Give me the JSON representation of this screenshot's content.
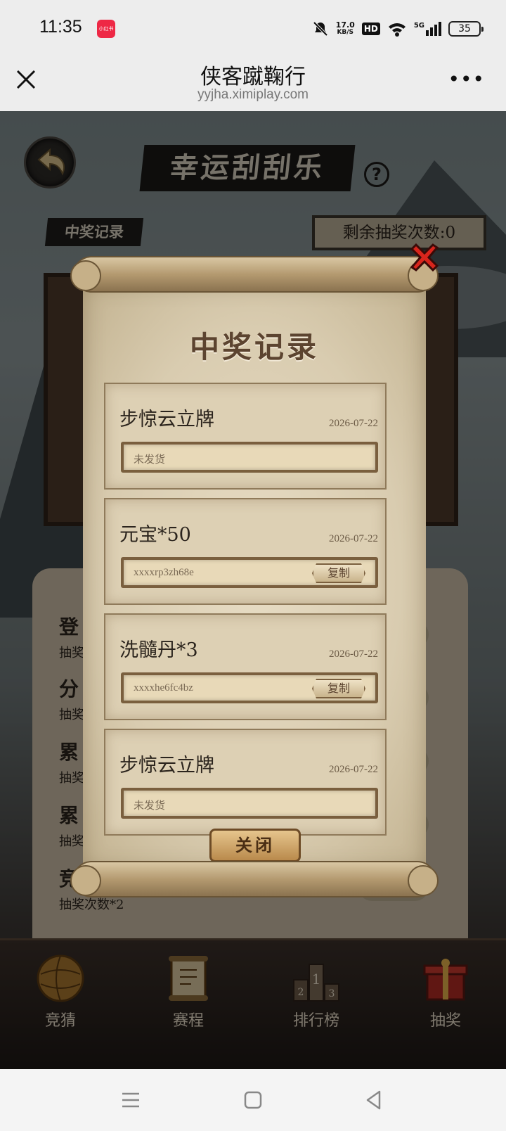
{
  "status_bar": {
    "time": "11:35",
    "app_badge": "小红书",
    "net_speed": "17.0",
    "net_unit": "KB/S",
    "hd": "HD",
    "signal": "5G",
    "battery": "35"
  },
  "nav": {
    "title": "侠客蹴鞠行",
    "url": "yyjha.ximiplay.com"
  },
  "game": {
    "title": "幸运刮刮乐",
    "help": "?",
    "record_tag": "中奖记录",
    "remaining": "剩余抽奖次数:0",
    "bg_rows": [
      {
        "title": "登",
        "sub": "抽奖"
      },
      {
        "title": "分",
        "sub": "抽奖"
      },
      {
        "title": "累",
        "sub": "抽奖"
      },
      {
        "title": "累",
        "sub": "抽奖"
      },
      {
        "title": "竞",
        "sub": "抽奖次数*2"
      }
    ],
    "tabs": [
      {
        "label": "竞猜"
      },
      {
        "label": "赛程"
      },
      {
        "label": "排行榜"
      },
      {
        "label": "抽奖"
      }
    ]
  },
  "modal": {
    "title": "中奖记录",
    "records": [
      {
        "name": "步惊云立牌",
        "date": "2026-07-22",
        "code": "未发货",
        "copy": ""
      },
      {
        "name": "元宝*50",
        "date": "2026-07-22",
        "code": "xxxxrp3zh68e",
        "copy": "复制"
      },
      {
        "name": "洗髓丹*3",
        "date": "2026-07-22",
        "code": "xxxxhe6fc4bz",
        "copy": "复制"
      },
      {
        "name": "步惊云立牌",
        "date": "2026-07-22",
        "code": "未发货",
        "copy": ""
      }
    ],
    "close_label": "关闭"
  }
}
